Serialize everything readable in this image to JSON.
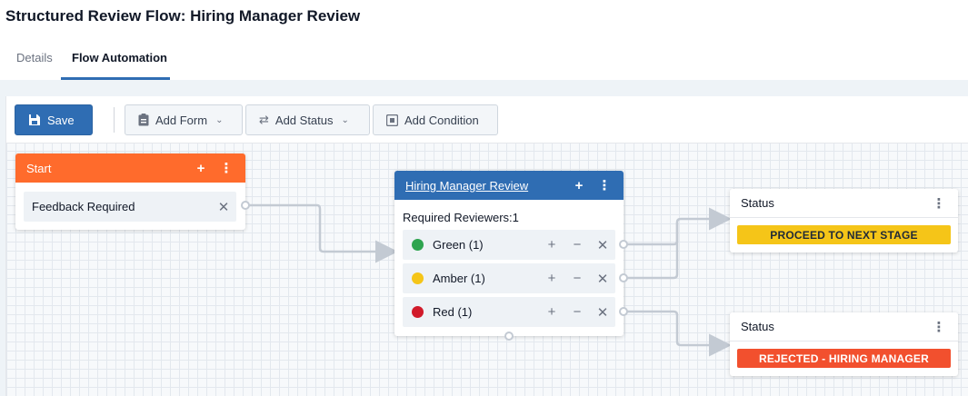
{
  "page": {
    "title": "Structured Review Flow: Hiring Manager Review"
  },
  "tabs": [
    {
      "label": "Details",
      "active": false
    },
    {
      "label": "Flow Automation",
      "active": true
    }
  ],
  "toolbar": {
    "save_label": "Save",
    "add_form_label": "Add Form",
    "add_status_label": "Add Status",
    "add_condition_label": "Add Condition"
  },
  "nodes": {
    "start": {
      "title": "Start",
      "header_color": "#ff6b2c",
      "row_label": "Feedback Required"
    },
    "review": {
      "title": "Hiring Manager Review",
      "header_color": "#2f6db3",
      "required_text": "Required Reviewers:1",
      "options": [
        {
          "label": "Green (1)",
          "color": "#2ea44f"
        },
        {
          "label": "Amber (1)",
          "color": "#f5c518"
        },
        {
          "label": "Red (1)",
          "color": "#d11a2a"
        }
      ]
    },
    "status_proceed": {
      "title": "Status",
      "pill_text": "PROCEED TO NEXT STAGE",
      "pill_color": "#f5c518",
      "pill_text_color": "#1f2937"
    },
    "status_rejected": {
      "title": "Status",
      "pill_text": "REJECTED - HIRING MANAGER",
      "pill_color": "#f2502e",
      "pill_text_color": "#ffffff"
    }
  },
  "icons": {
    "add": "+",
    "menu": "⋮",
    "close": "✕",
    "minus": "−",
    "save": "floppy-disk-icon",
    "form": "clipboard-icon",
    "status": "arrows-left-right-icon",
    "condition": "condition-icon"
  }
}
